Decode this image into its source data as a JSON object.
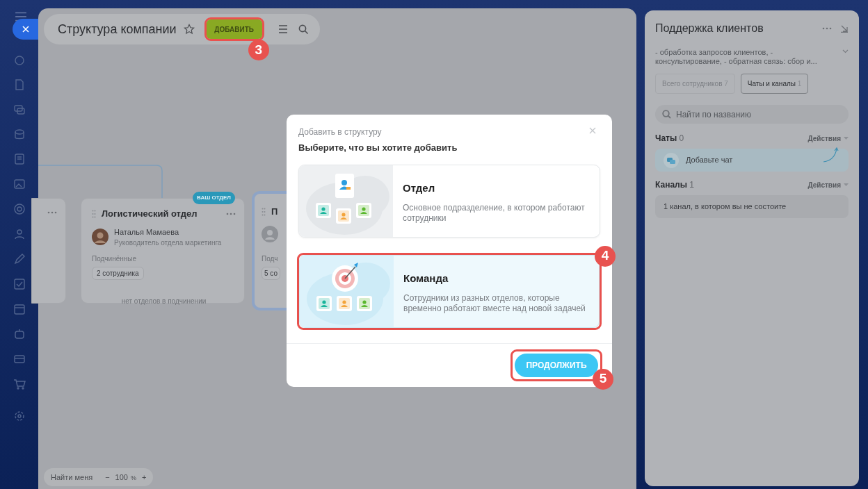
{
  "header": {
    "title": "Структура компании",
    "add_button": {
      "label": "ДОБАВИТЬ",
      "step": "3"
    }
  },
  "org_cards": [
    {
      "kind": "stub"
    },
    {
      "kind": "full",
      "title": "Логистический отдел",
      "badge": "ВАШ ОТДЕЛ",
      "person": "Наталья Мамаева",
      "role": "Руководитель отдела маркетинга",
      "subordinates_label": "Подчинённые",
      "subordinates": "2 сотрудника",
      "footer": "нет отделов в подчинении",
      "selected": false
    },
    {
      "kind": "cut",
      "title": "П",
      "subordinates_label": "Подч",
      "subordinates": "5 со",
      "selected": true
    }
  ],
  "zoom_bar": {
    "find_me": "Найти меня",
    "minus": "−",
    "value": "100",
    "unit": "%",
    "plus": "+"
  },
  "panel": {
    "title": "Поддержка клиентов",
    "description": "- обработка запросов клиентов, - консультирование, - обратная связь: сбор и...",
    "tabs": [
      {
        "label": "Всего сотрудников",
        "count": "7",
        "selected": false
      },
      {
        "label": "Чаты и каналы",
        "count": "1",
        "selected": true
      }
    ],
    "search": {
      "placeholder": "Найти по названию"
    },
    "sections": [
      {
        "title": "Чаты",
        "count": "0",
        "action": "Действия",
        "kind": "chat",
        "item": "Добавьте чат"
      },
      {
        "title": "Каналы",
        "count": "1",
        "action": "Действия",
        "kind": "note",
        "item": "1 канал, в котором вы не состоите"
      }
    ]
  },
  "modal": {
    "subtitle": "Добавить в структуру",
    "title": "Выберите, что вы хотите добавить",
    "options": [
      {
        "kind": "department",
        "title": "Отдел",
        "description": "Основное подразделение, в котором работают сотрудники",
        "selected": false
      },
      {
        "kind": "team",
        "title": "Команда",
        "description": "Сотрудники из разных отделов, которые временно работают вместе над новой задачей",
        "selected": true,
        "step": "4"
      }
    ],
    "continue_button": {
      "label": "ПРОДОЛЖИТЬ",
      "step": "5"
    }
  }
}
